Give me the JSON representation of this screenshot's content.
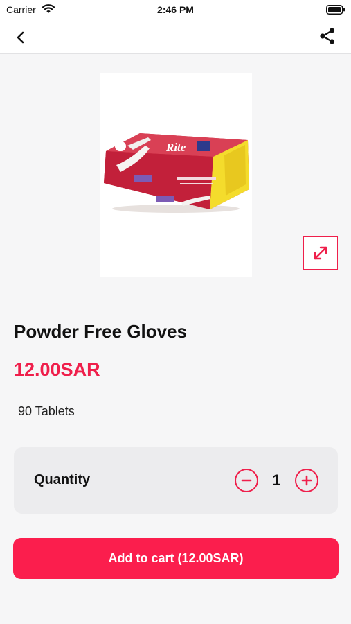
{
  "status_bar": {
    "carrier": "Carrier",
    "time": "2:46 PM"
  },
  "nav": {
    "back_icon": "chevron-left-icon",
    "share_icon": "share-icon"
  },
  "product": {
    "image_icon": "product-gloves-box",
    "expand_icon": "expand-icon",
    "title": "Powder Free Gloves",
    "price": "12.00SAR",
    "description": "90 Tablets"
  },
  "quantity": {
    "label": "Quantity",
    "value": "1"
  },
  "cart": {
    "button_label": "Add to cart (12.00SAR)"
  },
  "colors": {
    "accent": "#ef1f4b",
    "button": "#fb1e4d",
    "background": "#f6f6f7",
    "card": "#ececee"
  }
}
